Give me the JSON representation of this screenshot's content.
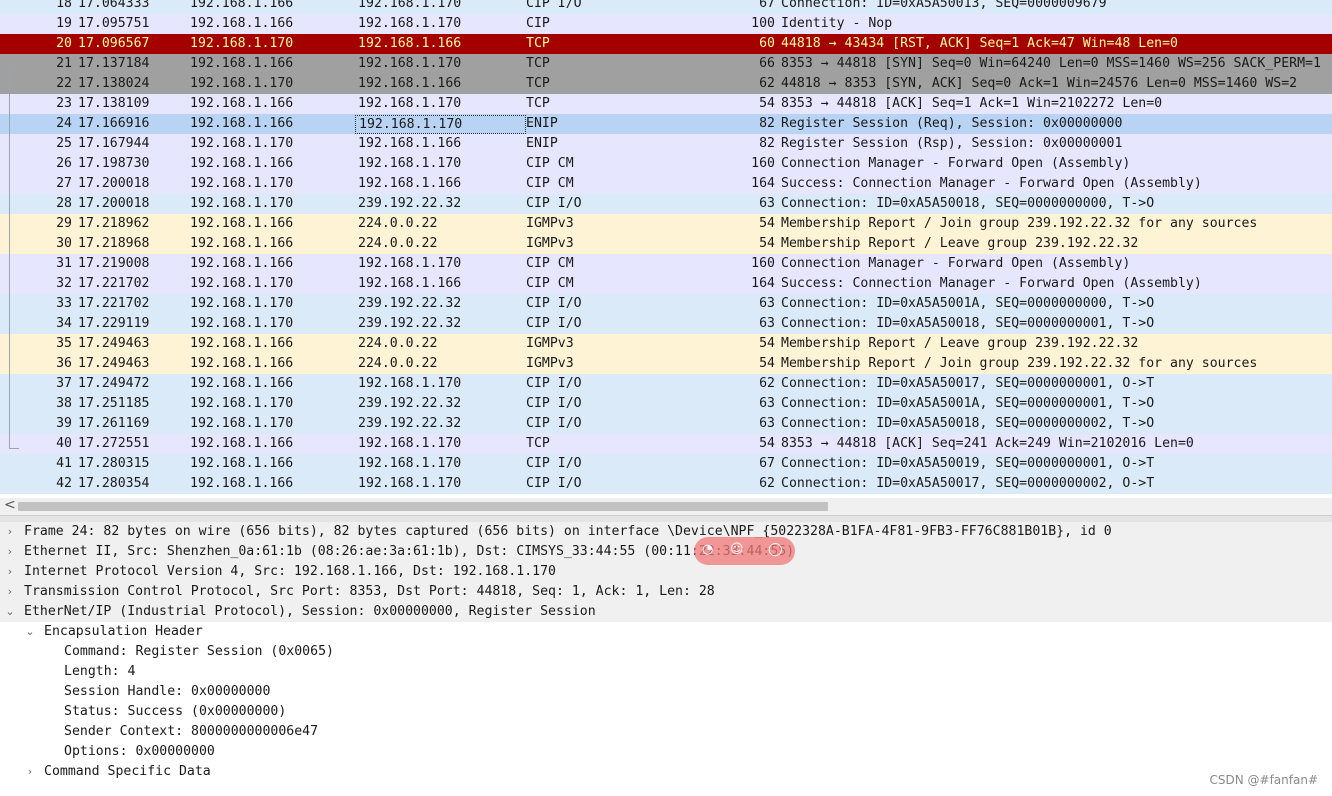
{
  "colors": {
    "cip": "#e7e6ff",
    "cipio": "#dbeaf8",
    "tcp": "#e7e6ff",
    "rst": "#a40000",
    "rst_text": "#fffc9c",
    "syn": "#a0a0a0",
    "igmp": "#fff3d6",
    "selected": "#b9d3f5"
  },
  "packets": [
    {
      "no": "18",
      "time": "17.064333",
      "src": "192.168.1.166",
      "dst": "192.168.1.170",
      "proto": "CIP I/O",
      "len": "67",
      "info": "Connection: ID=0xA5A50013, SEQ=0000009679",
      "style": "cipio"
    },
    {
      "no": "19",
      "time": "17.095751",
      "src": "192.168.1.166",
      "dst": "192.168.1.170",
      "proto": "CIP",
      "len": "100",
      "info": "Identity - Nop",
      "style": "cip"
    },
    {
      "no": "20",
      "time": "17.096567",
      "src": "192.168.1.170",
      "dst": "192.168.1.166",
      "proto": "TCP",
      "len": "60",
      "info": "44818 → 43434 [RST, ACK] Seq=1 Ack=47 Win=48 Len=0",
      "style": "rst"
    },
    {
      "no": "21",
      "time": "17.137184",
      "src": "192.168.1.166",
      "dst": "192.168.1.170",
      "proto": "TCP",
      "len": "66",
      "info": "8353 → 44818 [SYN] Seq=0 Win=64240 Len=0 MSS=1460 WS=256 SACK_PERM=1",
      "style": "syn"
    },
    {
      "no": "22",
      "time": "17.138024",
      "src": "192.168.1.170",
      "dst": "192.168.1.166",
      "proto": "TCP",
      "len": "62",
      "info": "44818 → 8353 [SYN, ACK] Seq=0 Ack=1 Win=24576 Len=0 MSS=1460 WS=2",
      "style": "syn"
    },
    {
      "no": "23",
      "time": "17.138109",
      "src": "192.168.1.166",
      "dst": "192.168.1.170",
      "proto": "TCP",
      "len": "54",
      "info": "8353 → 44818 [ACK] Seq=1 Ack=1 Win=2102272 Len=0",
      "style": "tcp"
    },
    {
      "no": "24",
      "time": "17.166916",
      "src": "192.168.1.166",
      "dst": "192.168.1.170",
      "proto": "ENIP",
      "len": "82",
      "info": "Register Session (Req), Session: 0x00000000",
      "style": "selected"
    },
    {
      "no": "25",
      "time": "17.167944",
      "src": "192.168.1.170",
      "dst": "192.168.1.166",
      "proto": "ENIP",
      "len": "82",
      "info": "Register Session (Rsp), Session: 0x00000001",
      "style": "cip"
    },
    {
      "no": "26",
      "time": "17.198730",
      "src": "192.168.1.166",
      "dst": "192.168.1.170",
      "proto": "CIP CM",
      "len": "160",
      "info": "Connection Manager - Forward Open (Assembly)",
      "style": "cip"
    },
    {
      "no": "27",
      "time": "17.200018",
      "src": "192.168.1.170",
      "dst": "192.168.1.166",
      "proto": "CIP CM",
      "len": "164",
      "info": "Success: Connection Manager - Forward Open (Assembly)",
      "style": "cip"
    },
    {
      "no": "28",
      "time": "17.200018",
      "src": "192.168.1.170",
      "dst": "239.192.22.32",
      "proto": "CIP I/O",
      "len": "63",
      "info": "Connection: ID=0xA5A50018, SEQ=0000000000, T->O",
      "style": "cipio"
    },
    {
      "no": "29",
      "time": "17.218962",
      "src": "192.168.1.166",
      "dst": "224.0.0.22",
      "proto": "IGMPv3",
      "len": "54",
      "info": "Membership Report / Join group 239.192.22.32 for any sources",
      "style": "igmp"
    },
    {
      "no": "30",
      "time": "17.218968",
      "src": "192.168.1.166",
      "dst": "224.0.0.22",
      "proto": "IGMPv3",
      "len": "54",
      "info": "Membership Report / Leave group 239.192.22.32",
      "style": "igmp"
    },
    {
      "no": "31",
      "time": "17.219008",
      "src": "192.168.1.166",
      "dst": "192.168.1.170",
      "proto": "CIP CM",
      "len": "160",
      "info": "Connection Manager - Forward Open (Assembly)",
      "style": "cip"
    },
    {
      "no": "32",
      "time": "17.221702",
      "src": "192.168.1.170",
      "dst": "192.168.1.166",
      "proto": "CIP CM",
      "len": "164",
      "info": "Success: Connection Manager - Forward Open (Assembly)",
      "style": "cip"
    },
    {
      "no": "33",
      "time": "17.221702",
      "src": "192.168.1.170",
      "dst": "239.192.22.32",
      "proto": "CIP I/O",
      "len": "63",
      "info": "Connection: ID=0xA5A5001A, SEQ=0000000000, T->O",
      "style": "cipio"
    },
    {
      "no": "34",
      "time": "17.229119",
      "src": "192.168.1.170",
      "dst": "239.192.22.32",
      "proto": "CIP I/O",
      "len": "63",
      "info": "Connection: ID=0xA5A50018, SEQ=0000000001, T->O",
      "style": "cipio"
    },
    {
      "no": "35",
      "time": "17.249463",
      "src": "192.168.1.166",
      "dst": "224.0.0.22",
      "proto": "IGMPv3",
      "len": "54",
      "info": "Membership Report / Leave group 239.192.22.32",
      "style": "igmp"
    },
    {
      "no": "36",
      "time": "17.249463",
      "src": "192.168.1.166",
      "dst": "224.0.0.22",
      "proto": "IGMPv3",
      "len": "54",
      "info": "Membership Report / Join group 239.192.22.32 for any sources",
      "style": "igmp"
    },
    {
      "no": "37",
      "time": "17.249472",
      "src": "192.168.1.166",
      "dst": "192.168.1.170",
      "proto": "CIP I/O",
      "len": "62",
      "info": "Connection: ID=0xA5A50017, SEQ=0000000001, O->T",
      "style": "cipio"
    },
    {
      "no": "38",
      "time": "17.251185",
      "src": "192.168.1.170",
      "dst": "239.192.22.32",
      "proto": "CIP I/O",
      "len": "63",
      "info": "Connection: ID=0xA5A5001A, SEQ=0000000001, T->O",
      "style": "cipio"
    },
    {
      "no": "39",
      "time": "17.261169",
      "src": "192.168.1.170",
      "dst": "239.192.22.32",
      "proto": "CIP I/O",
      "len": "63",
      "info": "Connection: ID=0xA5A50018, SEQ=0000000002, T->O",
      "style": "cipio"
    },
    {
      "no": "40",
      "time": "17.272551",
      "src": "192.168.1.166",
      "dst": "192.168.1.170",
      "proto": "TCP",
      "len": "54",
      "info": "8353 → 44818 [ACK] Seq=241 Ack=249 Win=2102016 Len=0",
      "style": "tcp"
    },
    {
      "no": "41",
      "time": "17.280315",
      "src": "192.168.1.166",
      "dst": "192.168.1.170",
      "proto": "CIP I/O",
      "len": "67",
      "info": "Connection: ID=0xA5A50019, SEQ=0000000001, O->T",
      "style": "cipio"
    },
    {
      "no": "42",
      "time": "17.280354",
      "src": "192.168.1.166",
      "dst": "192.168.1.170",
      "proto": "CIP I/O",
      "len": "62",
      "info": "Connection: ID=0xA5A50017, SEQ=0000000002, O->T",
      "style": "cipio"
    }
  ],
  "details": [
    {
      "level": 0,
      "toggle": "collapsed",
      "text": "Frame 24: 82 bytes on wire (656 bits), 82 bytes captured (656 bits) on interface \\Device\\NPF_{5022328A-B1FA-4F81-9FB3-FF76C881B01B}, id 0",
      "hl": true
    },
    {
      "level": 0,
      "toggle": "collapsed",
      "text": "Ethernet II, Src: Shenzhen_0a:61:1b (08:26:ae:3a:61:1b), Dst: CIMSYS_33:44:55 (00:11:22:33:44:55)",
      "hl": true
    },
    {
      "level": 0,
      "toggle": "collapsed",
      "text": "Internet Protocol Version 4, Src: 192.168.1.166, Dst: 192.168.1.170",
      "hl": true
    },
    {
      "level": 0,
      "toggle": "collapsed",
      "text": "Transmission Control Protocol, Src Port: 8353, Dst Port: 44818, Seq: 1, Ack: 1, Len: 28",
      "hl": true
    },
    {
      "level": 0,
      "toggle": "expanded",
      "text": "EtherNet/IP (Industrial Protocol), Session: 0x00000000, Register Session",
      "hl": true
    },
    {
      "level": 1,
      "toggle": "expanded",
      "text": "Encapsulation Header",
      "hl": false
    },
    {
      "level": 2,
      "toggle": "",
      "text": "Command: Register Session (0x0065)",
      "hl": false
    },
    {
      "level": 2,
      "toggle": "",
      "text": "Length: 4",
      "hl": false
    },
    {
      "level": 2,
      "toggle": "",
      "text": "Session Handle: 0x00000000",
      "hl": false
    },
    {
      "level": 2,
      "toggle": "",
      "text": "Status: Success (0x00000000)",
      "hl": false
    },
    {
      "level": 2,
      "toggle": "",
      "text": "Sender Context: 8000000000006e47",
      "hl": false
    },
    {
      "level": 2,
      "toggle": "",
      "text": "Options: 0x00000000",
      "hl": false
    },
    {
      "level": 1,
      "toggle": "collapsed",
      "text": "Command Specific Data",
      "hl": false
    }
  ],
  "watermark": "CSDN @#fanfan#",
  "toggle_glyphs": {
    "collapsed": "›",
    "expanded": "⌄"
  },
  "scroll_left_glyph": "<"
}
